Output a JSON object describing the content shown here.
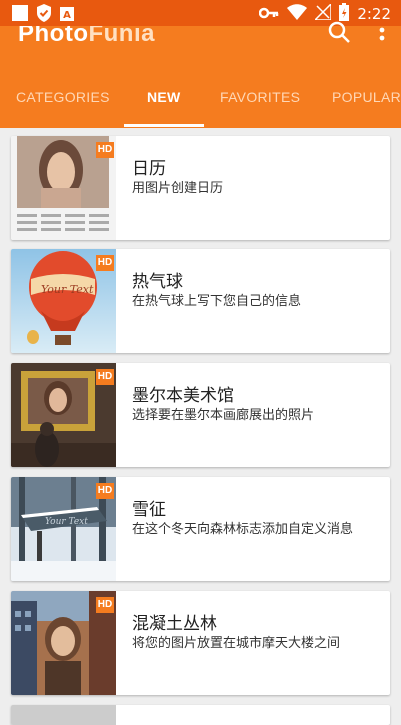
{
  "status_bar": {
    "time": "2:22"
  },
  "app_bar": {
    "logo_part1": "Photo",
    "logo_part2": "Funia",
    "search_icon": "search-icon",
    "more_icon": "more-vertical-icon"
  },
  "tabs": [
    {
      "label": "CATEGORIES"
    },
    {
      "label": "NEW"
    },
    {
      "label": "FAVORITES"
    },
    {
      "label": "POPULAR"
    }
  ],
  "colors": {
    "accent": "#f57c1f",
    "status_bar": "#e8590f",
    "hd_badge": "#f57c1f"
  },
  "items": [
    {
      "title": "日历",
      "description": "用图片创建日历",
      "badge": "HD"
    },
    {
      "title": "热气球",
      "description": "在热气球上写下您自己的信息",
      "badge": "HD"
    },
    {
      "title": "墨尔本美术馆",
      "description": "选择要在墨尔本画廊展出的照片",
      "badge": "HD"
    },
    {
      "title": "雪征",
      "description": "在这个冬天向森林标志添加自定义消息",
      "badge": "HD"
    },
    {
      "title": "混凝土丛林",
      "description": "将您的图片放置在城市摩天大楼之间",
      "badge": "HD"
    }
  ]
}
